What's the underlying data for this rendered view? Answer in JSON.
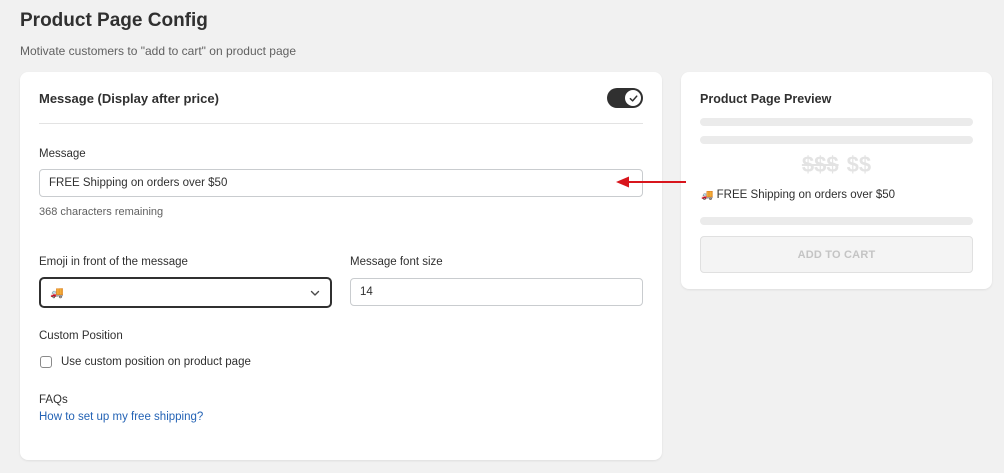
{
  "page": {
    "title": "Product Page Config",
    "subtitle": "Motivate customers to \"add to cart\" on product page"
  },
  "main_card": {
    "title": "Message (Display after price)",
    "toggle_on": true,
    "message_label": "Message",
    "message_value": "FREE Shipping on orders over $50",
    "chars_remaining": "368 characters remaining",
    "emoji_label": "Emoji in front of the message",
    "emoji_value": "🚚",
    "font_size_label": "Message font size",
    "font_size_value": "14",
    "custom_position_label": "Custom Position",
    "custom_position_checkbox_label": "Use custom position on product page",
    "custom_position_checked": false,
    "faqs_label": "FAQs",
    "faqs_link": "How to set up my free shipping?"
  },
  "preview_card": {
    "title": "Product Page Preview",
    "old_price": "$$$",
    "price": "$$",
    "message_emoji": "🚚",
    "message_text": "FREE Shipping on orders over $50",
    "add_to_cart_label": "ADD TO CART"
  },
  "colors": {
    "background": "#f1f1f1",
    "toggle": "#303030",
    "link": "#2463b5",
    "annotation_arrow": "#d8151c"
  }
}
